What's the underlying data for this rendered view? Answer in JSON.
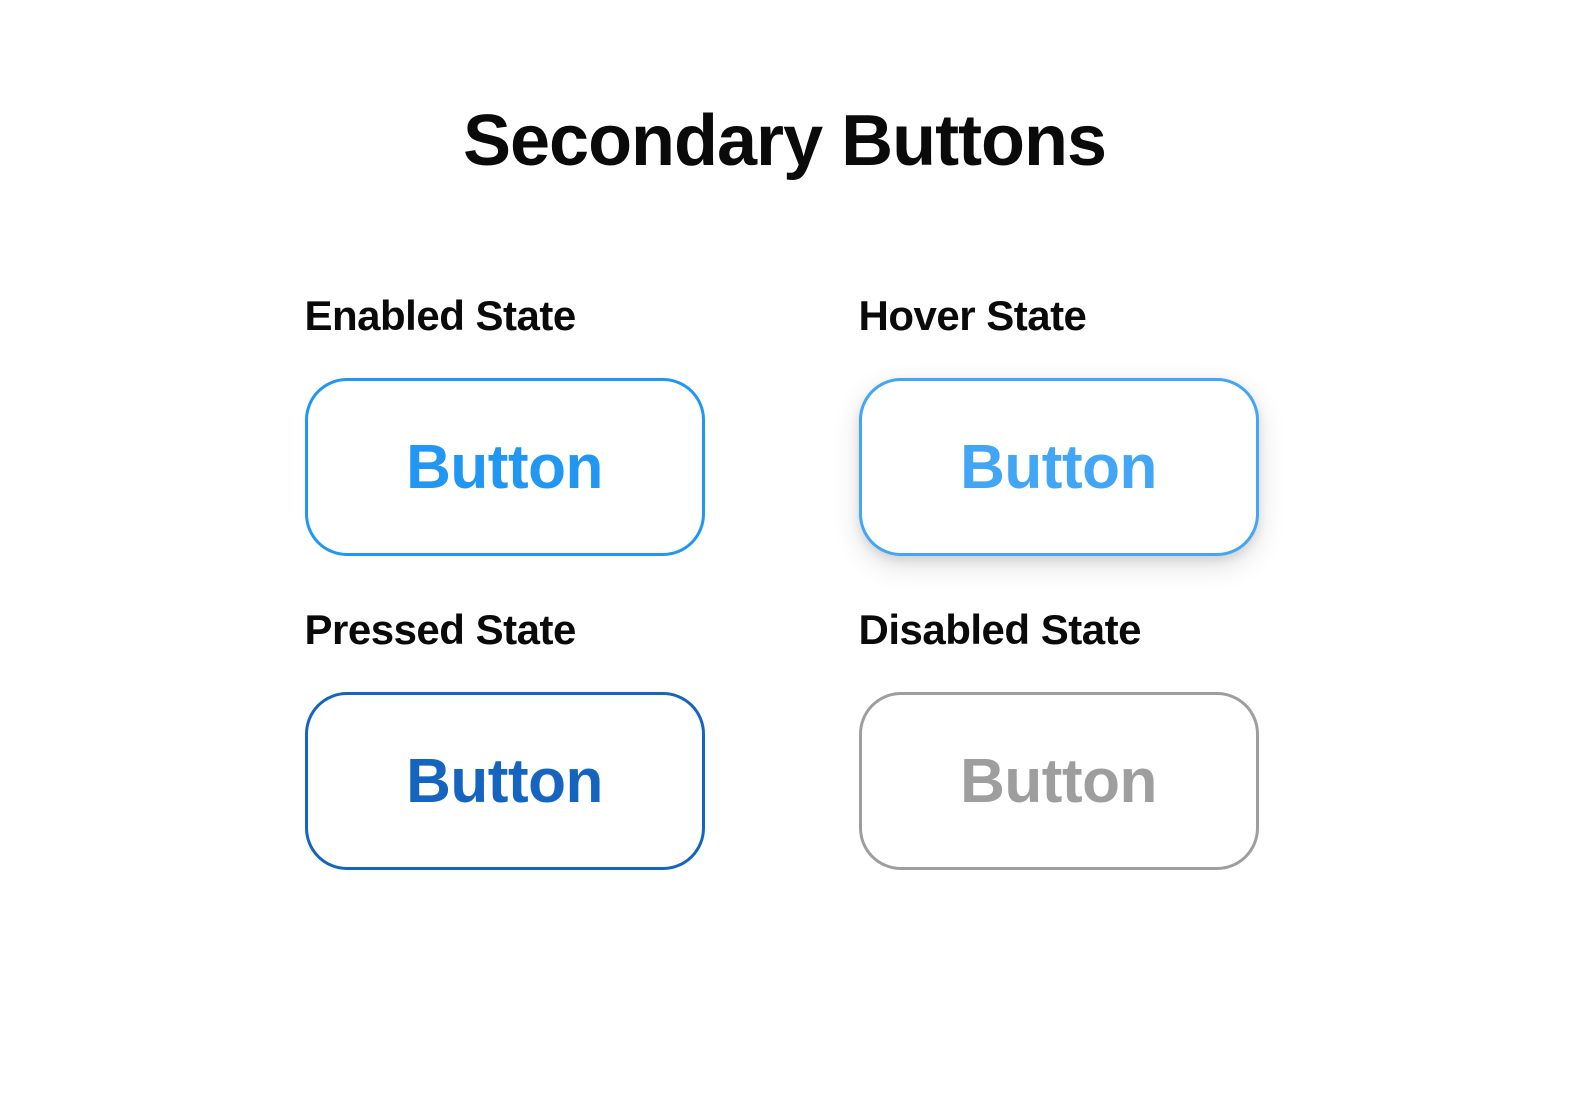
{
  "title": "Secondary Buttons",
  "states": {
    "enabled": {
      "label": "Enabled State",
      "button_text": "Button"
    },
    "hover": {
      "label": "Hover State",
      "button_text": "Button"
    },
    "pressed": {
      "label": "Pressed State",
      "button_text": "Button"
    },
    "disabled": {
      "label": "Disabled State",
      "button_text": "Button"
    }
  },
  "colors": {
    "enabled": "#2196f3",
    "hover": "#42a5f5",
    "pressed": "#1565c0",
    "disabled": "#9e9e9e",
    "text_dark": "#0a0a0a"
  }
}
